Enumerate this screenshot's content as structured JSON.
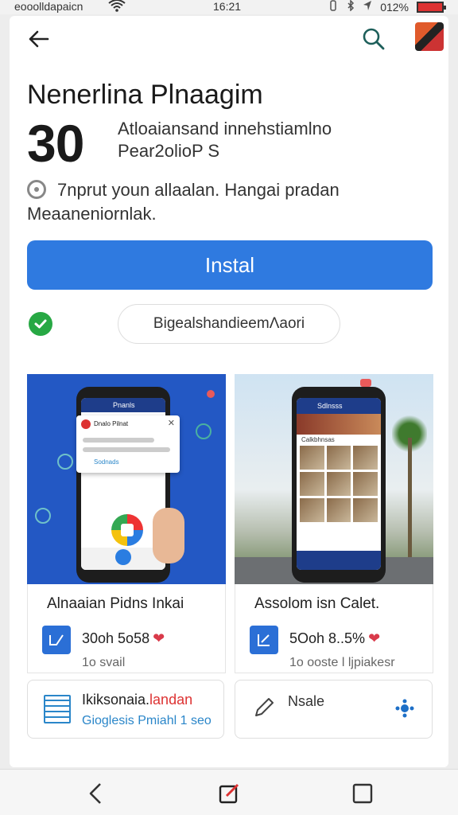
{
  "status_bar": {
    "carrier": "eooolldapaicn",
    "time": "16:21",
    "battery": "012%"
  },
  "app": {
    "title": "Nenerlina Plnaagim",
    "rating_big": "30",
    "rating_desc_line1": "Atloaiansand innehstiamlno",
    "rating_desc_line2": "Pear2olioP S",
    "info_line1": "7nprut youn allaalan. Hangai pradan",
    "info_line2": "Meaaneniornlak."
  },
  "actions": {
    "install_label": "Instal",
    "secondary_label": "BigealshandieemΛaori"
  },
  "screenshots": [
    {
      "popup_title": "Dnalo Pilnat",
      "popup_row": "Sodnads",
      "screen_label": "Pnanls"
    },
    {
      "screen_label": "Sdlnsss",
      "list_label": "Calkbhnsas"
    }
  ],
  "related_apps": [
    {
      "name": "Alnaaian Pidns Inkai",
      "stats": "30oh 5o58",
      "sub": "1o svail"
    },
    {
      "name": "Assolom isn Calet.",
      "stats": "5Ooh 8..5%",
      "sub": "1o ooste l ljpiakesr"
    }
  ],
  "bottom_cards": [
    {
      "title_plain": "Ikiksonaia.",
      "title_highlight": "landan",
      "sub": "Gioglesis Pmiahl 1 seo"
    },
    {
      "title": "Nsale"
    }
  ],
  "colors": {
    "accent": "#2f7ae0",
    "verified": "#27a844",
    "heart": "#d93a4a",
    "link": "#2a86c9"
  },
  "icons": [
    "back-arrow-icon",
    "search-icon",
    "avatar",
    "info-icon",
    "check-icon",
    "heart-icon",
    "pen-icon",
    "gear-icon",
    "nav-back-icon",
    "nav-edit-icon",
    "nav-recent-icon"
  ]
}
